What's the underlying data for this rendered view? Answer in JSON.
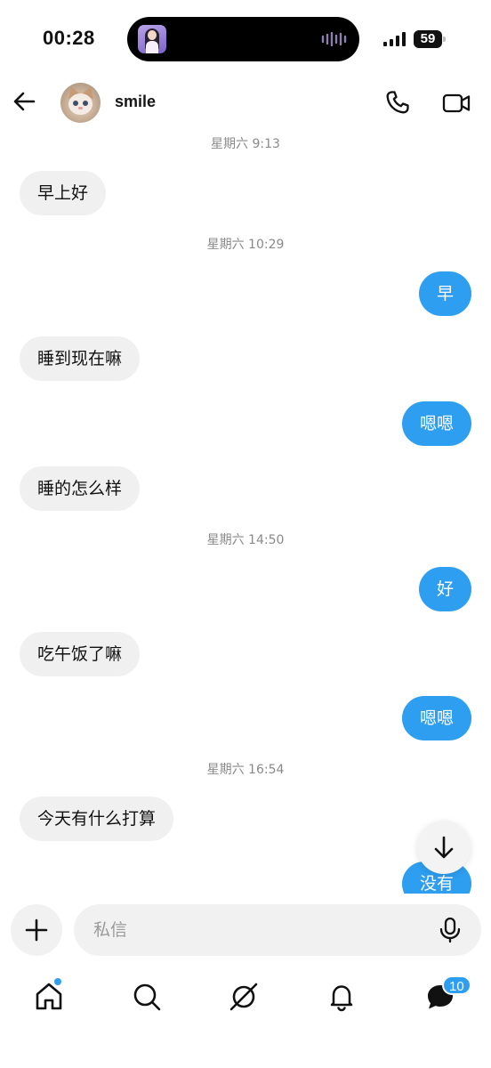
{
  "status_bar": {
    "time": "00:28",
    "battery": "59"
  },
  "header": {
    "contact_name": "smile"
  },
  "messages": [
    {
      "type": "timestamp",
      "text": "星期六 9:13"
    },
    {
      "type": "in",
      "text": "早上好"
    },
    {
      "type": "timestamp",
      "text": "星期六 10:29"
    },
    {
      "type": "out",
      "text": "早"
    },
    {
      "type": "in",
      "text": "睡到现在嘛"
    },
    {
      "type": "out",
      "text": "嗯嗯"
    },
    {
      "type": "in",
      "text": "睡的怎么样"
    },
    {
      "type": "timestamp",
      "text": "星期六 14:50"
    },
    {
      "type": "out",
      "text": "好"
    },
    {
      "type": "in",
      "text": "吃午饭了嘛"
    },
    {
      "type": "out",
      "text": "嗯嗯"
    },
    {
      "type": "timestamp",
      "text": "星期六 16:54"
    },
    {
      "type": "in",
      "text": "今天有什么打算"
    },
    {
      "type": "out",
      "text": "没有"
    }
  ],
  "composer": {
    "placeholder": "私信"
  },
  "nav": {
    "inbox_badge": "10"
  },
  "colors": {
    "accent": "#2d9ef0",
    "incoming_bubble": "#f0f0f0"
  },
  "icons": [
    "back-arrow-icon",
    "phone-icon",
    "video-icon",
    "arrow-down-icon",
    "plus-icon",
    "mic-icon",
    "home-icon",
    "search-icon",
    "explore-icon",
    "bell-icon",
    "chat-icon"
  ]
}
